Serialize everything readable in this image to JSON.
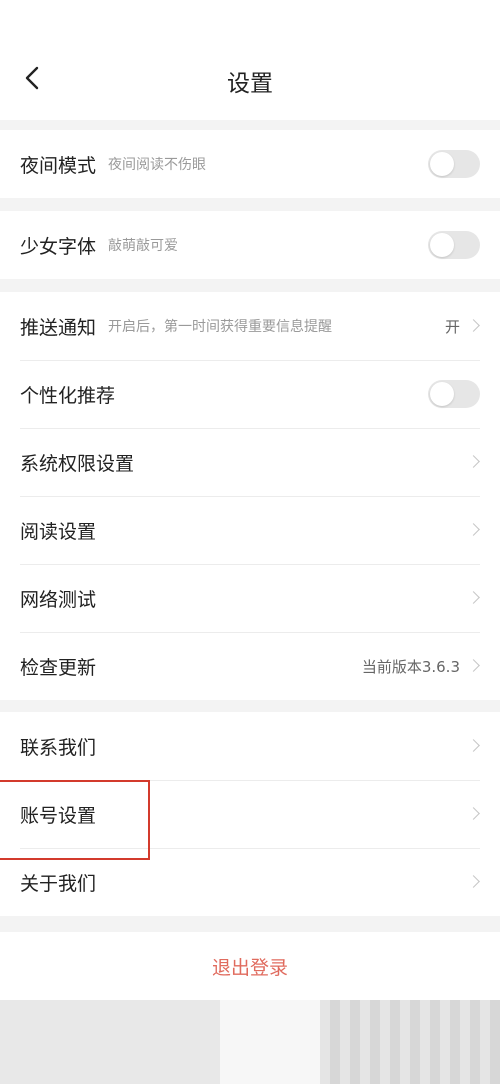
{
  "header": {
    "title": "设置"
  },
  "sections": [
    {
      "rows": [
        {
          "label": "夜间模式",
          "desc": "夜间阅读不伤眼",
          "type": "toggle",
          "on": false
        }
      ]
    },
    {
      "rows": [
        {
          "label": "少女字体",
          "desc": "敲萌敲可爱",
          "type": "toggle",
          "on": false
        }
      ]
    },
    {
      "rows": [
        {
          "label": "推送通知",
          "desc": "开启后，第一时间获得重要信息提醒",
          "value": "开",
          "type": "link"
        },
        {
          "label": "个性化推荐",
          "type": "toggle",
          "on": false
        },
        {
          "label": "系统权限设置",
          "type": "link"
        },
        {
          "label": "阅读设置",
          "type": "link"
        },
        {
          "label": "网络测试",
          "type": "link"
        },
        {
          "label": "检查更新",
          "value": "当前版本3.6.3",
          "type": "link"
        }
      ]
    },
    {
      "rows": [
        {
          "label": "联系我们",
          "type": "link"
        },
        {
          "label": "账号设置",
          "type": "link"
        },
        {
          "label": "关于我们",
          "type": "link"
        }
      ]
    }
  ],
  "logout": {
    "label": "退出登录"
  },
  "colors": {
    "accent": "#e06b5e",
    "highlight_border": "#d33a2c"
  }
}
